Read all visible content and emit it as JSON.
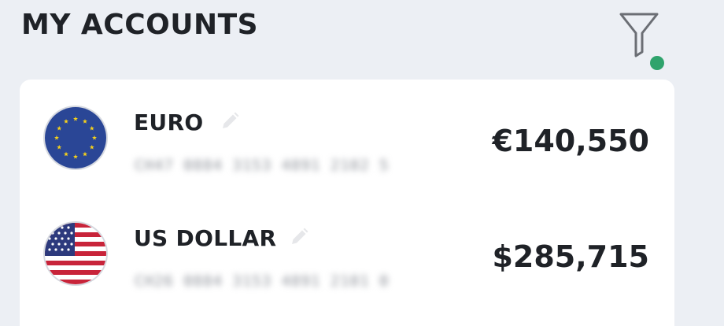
{
  "header": {
    "title": "MY ACCOUNTS",
    "filter_icon": "filter-icon",
    "filter_indicator_color": "#2fa36c"
  },
  "accounts": [
    {
      "currency_name": "EURO",
      "account_number": "CH47 0884 3153 4891 2102 5",
      "balance": "€140,550",
      "flag_icon": "eu-flag-icon",
      "edit_icon": "pencil-icon"
    },
    {
      "currency_name": "US DOLLAR",
      "account_number": "CH26 0884 3153 4891 2101 0",
      "balance": "$285,715",
      "flag_icon": "us-flag-icon",
      "edit_icon": "pencil-icon"
    }
  ],
  "colors": {
    "background": "#eceff4",
    "card": "#ffffff",
    "text": "#1f2227"
  }
}
